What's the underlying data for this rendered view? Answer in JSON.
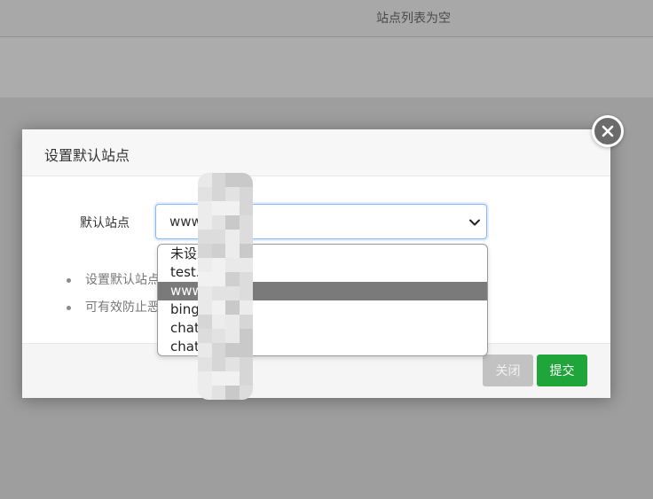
{
  "background": {
    "site_list_empty_text": "站点列表为空"
  },
  "modal": {
    "title": "设置默认站点",
    "form": {
      "label": "默认站点",
      "select_value": "www.l          op"
    },
    "tips": [
      "设置默认站点",
      "可有效防止恶"
    ],
    "footer": {
      "close_label": "关闭",
      "submit_label": "提交"
    }
  },
  "dropdown": {
    "options": [
      {
        "label": "未设置          点",
        "selected": false
      },
      {
        "label": "test.l          op",
        "selected": false
      },
      {
        "label": "www.           op",
        "selected": true
      },
      {
        "label": "bing           op",
        "selected": false
      },
      {
        "label": "chat",
        "selected": false
      },
      {
        "label": "chat           op",
        "selected": false
      }
    ]
  },
  "colors": {
    "accent_green": "#20a53a",
    "selected_option": "#7a7a7a",
    "focus_border": "#86b7fe"
  },
  "icons": {
    "modal_close": "close-icon",
    "select_arrow": "chevron-down-icon"
  }
}
